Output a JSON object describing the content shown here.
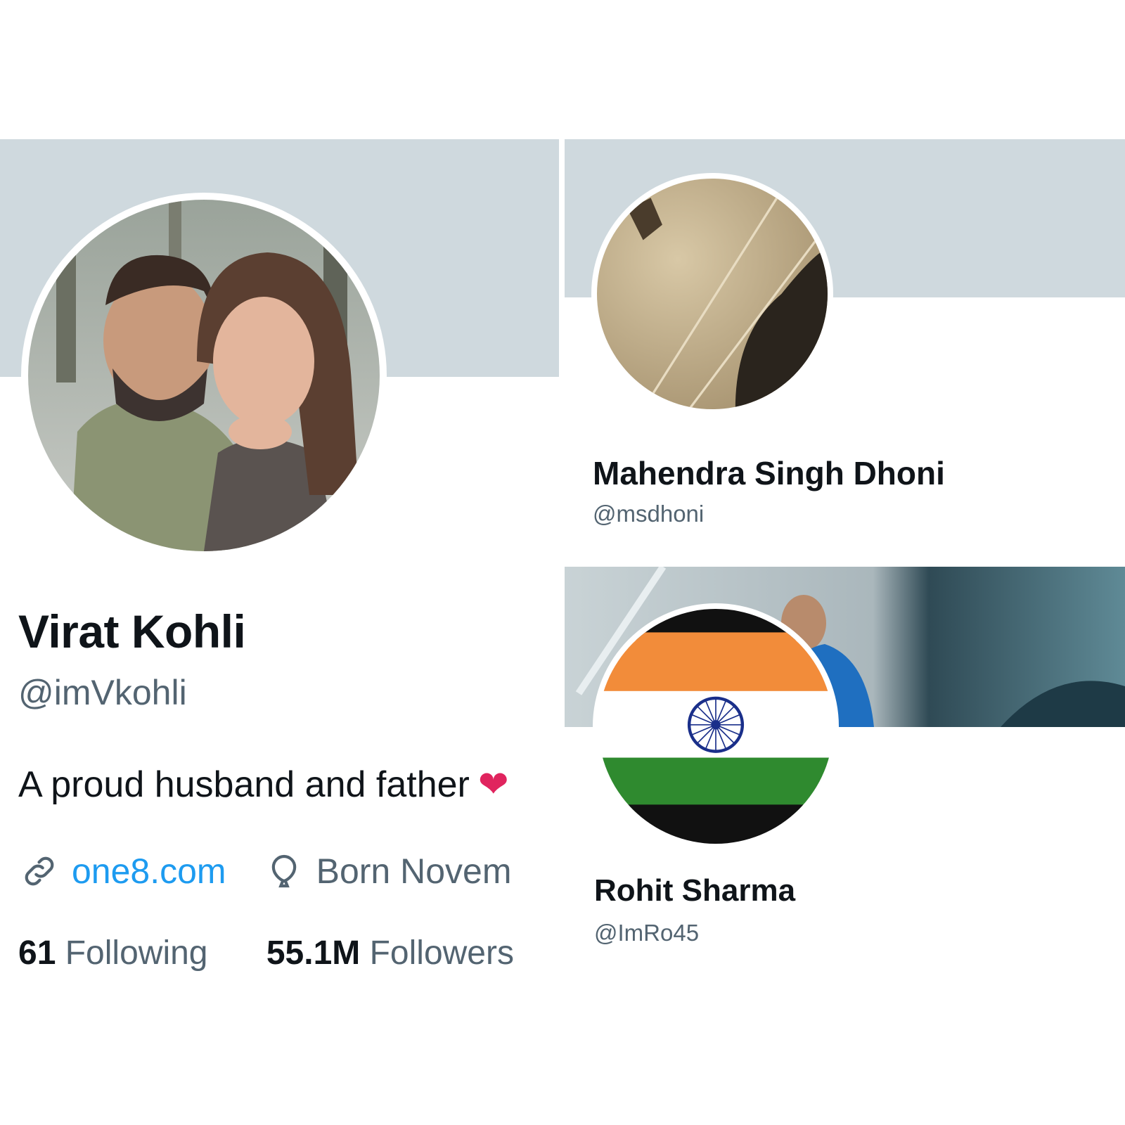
{
  "profiles": {
    "kohli": {
      "name": "Virat Kohli",
      "handle": "@imVkohli",
      "bio": "A proud husband and father",
      "bio_emoji": "❤",
      "website": "one8.com",
      "birth": "Born Novem",
      "following_count": "61",
      "following_label": "Following",
      "followers_count": "55.1M",
      "followers_label": "Followers"
    },
    "dhoni": {
      "name": "Mahendra Singh Dhoni",
      "handle": "@msdhoni"
    },
    "rohit": {
      "name": "Rohit Sharma",
      "handle": "@ImRo45"
    }
  },
  "icons": {
    "website": "link-icon",
    "birth": "balloon-icon"
  },
  "colors": {
    "link": "#1d9bf0",
    "secondary_text": "#536471",
    "banner_default": "#cfd9de",
    "heart": "#e0245e"
  }
}
